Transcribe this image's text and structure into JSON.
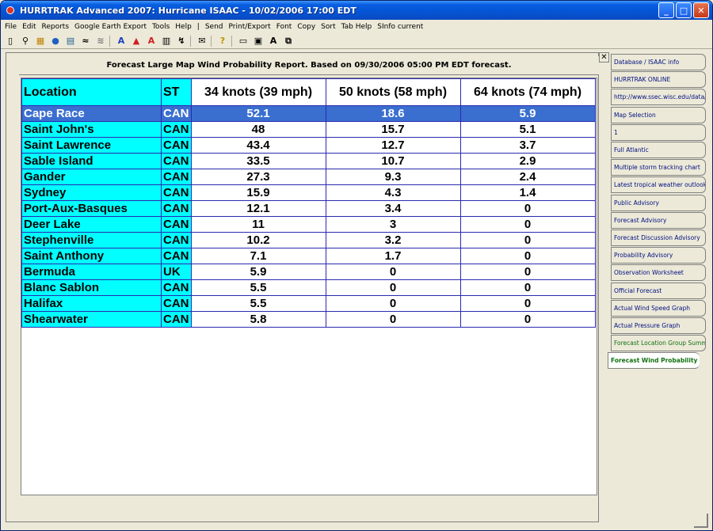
{
  "window": {
    "title": "HURRTRAK Advanced 2007: Hurricane ISAAC - 10/02/2006 17:00 EDT"
  },
  "menu": [
    "File",
    "Edit",
    "Reports",
    "Google Earth Export",
    "Tools",
    "Help",
    "|",
    "Send",
    "Print/Export",
    "Font",
    "Copy",
    "Sort",
    "Tab Help",
    "SInfo current"
  ],
  "report": {
    "title": "Forecast Large Map Wind Probability Report. Based on 09/30/2006 05:00 PM EDT forecast.",
    "columns": [
      "Location",
      "ST",
      "34 knots (39 mph)",
      "50 knots (58 mph)",
      "64 knots (74 mph)"
    ],
    "rows": [
      [
        "Cape Race",
        "CAN",
        "52.1",
        "18.6",
        "5.9"
      ],
      [
        "Saint John's",
        "CAN",
        "48",
        "15.7",
        "5.1"
      ],
      [
        "Saint Lawrence",
        "CAN",
        "43.4",
        "12.7",
        "3.7"
      ],
      [
        "Sable Island",
        "CAN",
        "33.5",
        "10.7",
        "2.9"
      ],
      [
        "Gander",
        "CAN",
        "27.3",
        "9.3",
        "2.4"
      ],
      [
        "Sydney",
        "CAN",
        "15.9",
        "4.3",
        "1.4"
      ],
      [
        "Port-Aux-Basques",
        "CAN",
        "12.1",
        "3.4",
        "0"
      ],
      [
        "Deer Lake",
        "CAN",
        "11",
        "3",
        "0"
      ],
      [
        "Stephenville",
        "CAN",
        "10.2",
        "3.2",
        "0"
      ],
      [
        "Saint Anthony",
        "CAN",
        "7.1",
        "1.7",
        "0"
      ],
      [
        "Bermuda",
        "UK",
        "5.9",
        "0",
        "0"
      ],
      [
        "Blanc Sablon",
        "CAN",
        "5.5",
        "0",
        "0"
      ],
      [
        "Halifax",
        "CAN",
        "5.5",
        "0",
        "0"
      ],
      [
        "Shearwater",
        "CAN",
        "5.8",
        "0",
        "0"
      ]
    ],
    "selected_row": 0
  },
  "tabs": [
    {
      "label": "Database / ISAAC info",
      "style": "normal"
    },
    {
      "label": "HURRTRAK ONLINE",
      "style": "normal"
    },
    {
      "label": "http://www.ssec.wisc.edu/data/gl",
      "style": "normal"
    },
    {
      "label": "Map Selection",
      "style": "normal"
    },
    {
      "label": "1",
      "style": "normal"
    },
    {
      "label": "Full Atlantic",
      "style": "normal"
    },
    {
      "label": "Multiple storm tracking chart",
      "style": "normal"
    },
    {
      "label": "Latest tropical weather outlook",
      "style": "normal"
    },
    {
      "label": "Public Advisory",
      "style": "normal"
    },
    {
      "label": "Forecast Advisory",
      "style": "normal"
    },
    {
      "label": "Forecast Discussion Advisory",
      "style": "normal"
    },
    {
      "label": "Probability Advisory",
      "style": "normal"
    },
    {
      "label": "Observation Worksheet",
      "style": "normal"
    },
    {
      "label": "Official Forecast",
      "style": "normal"
    },
    {
      "label": "Actual Wind Speed Graph",
      "style": "normal"
    },
    {
      "label": "Actual Pressure Graph",
      "style": "normal"
    },
    {
      "label": "Forecast Location Group Summary",
      "style": "green"
    },
    {
      "label": "Forecast Wind Probability",
      "style": "active"
    }
  ]
}
